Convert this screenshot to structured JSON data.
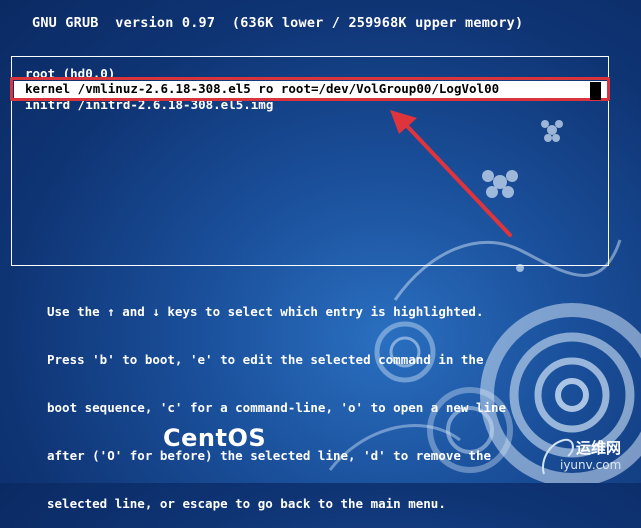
{
  "header": {
    "title": "GNU GRUB  version 0.97  (636K lower / 259968K upper memory)"
  },
  "menu": {
    "entries": [
      "root (hd0,0)",
      "kernel /vmlinuz-2.6.18-308.el5 ro root=/dev/VolGroup00/LogVol00",
      "initrd /initrd-2.6.18-308.el5.img"
    ],
    "selected_index": 1
  },
  "help": {
    "lines": [
      "Use the ↑ and ↓ keys to select which entry is highlighted.",
      "Press 'b' to boot, 'e' to edit the selected command in the",
      "boot sequence, 'c' for a command-line, 'o' to open a new line",
      "after ('O' for before) the selected line, 'd' to remove the",
      "selected line, or escape to go back to the main menu."
    ]
  },
  "branding": {
    "logo_text": "CentOS"
  },
  "watermark": {
    "title": "运维网",
    "url": "iyunv.com"
  },
  "colors": {
    "highlight_frame": "#d9333b",
    "arrow": "#e0343c",
    "background": "#1a4f9a"
  },
  "icons": {
    "arrow": "annotation-arrow-icon",
    "decor": "swirl-decoration-icon"
  }
}
